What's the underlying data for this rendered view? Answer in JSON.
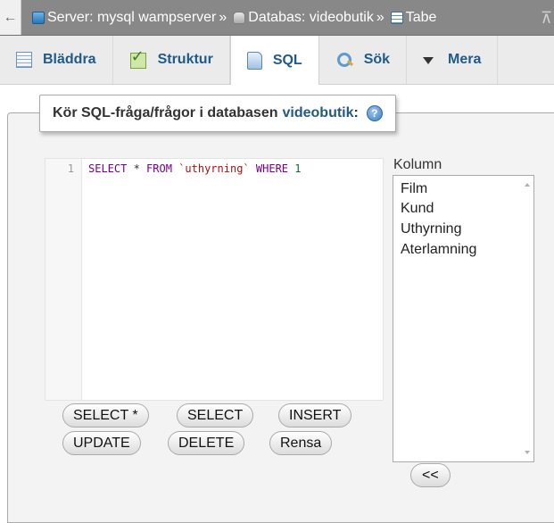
{
  "breadcrumb": {
    "back_glyph": "←",
    "server_label": "Server: mysql wampserver",
    "db_label": "Databas: videobutik",
    "table_label": "Tabe",
    "separator": "»",
    "overflow_glyph": "⊼"
  },
  "tabs": [
    {
      "label": "Bläddra",
      "icon": "browse-icon"
    },
    {
      "label": "Struktur",
      "icon": "structure-icon"
    },
    {
      "label": "SQL",
      "icon": "sql-icon",
      "active": true
    },
    {
      "label": "Sök",
      "icon": "search-icon"
    },
    {
      "label": "Mera",
      "icon": "chevron-down-icon"
    }
  ],
  "query_panel": {
    "legend_prefix": "Kör SQL-fråga/frågor i databasen",
    "database": "videobutik",
    "colon": ":",
    "help_glyph": "?"
  },
  "editor": {
    "line_number": "1",
    "tokens": {
      "select": "SELECT",
      "star": " * ",
      "from": "FROM",
      "space1": " ",
      "table": "`uthyrning`",
      "space2": " ",
      "where": "WHERE",
      "space3": " ",
      "one": "1"
    }
  },
  "buttons": {
    "select_star": "SELECT *",
    "select": "SELECT",
    "insert": "INSERT",
    "update": "UPDATE",
    "delete": "DELETE",
    "clear": "Rensa",
    "insert_column": "<<"
  },
  "columns": {
    "label": "Kolumn",
    "items": [
      "Film",
      "Kund",
      "Uthyrning",
      "Aterlamning"
    ]
  },
  "colors": {
    "tab_text": "#1f5a8a",
    "keyword": "#770088",
    "string": "#aa1111",
    "number": "#116644",
    "breadcrumb_bg": "#888888"
  }
}
